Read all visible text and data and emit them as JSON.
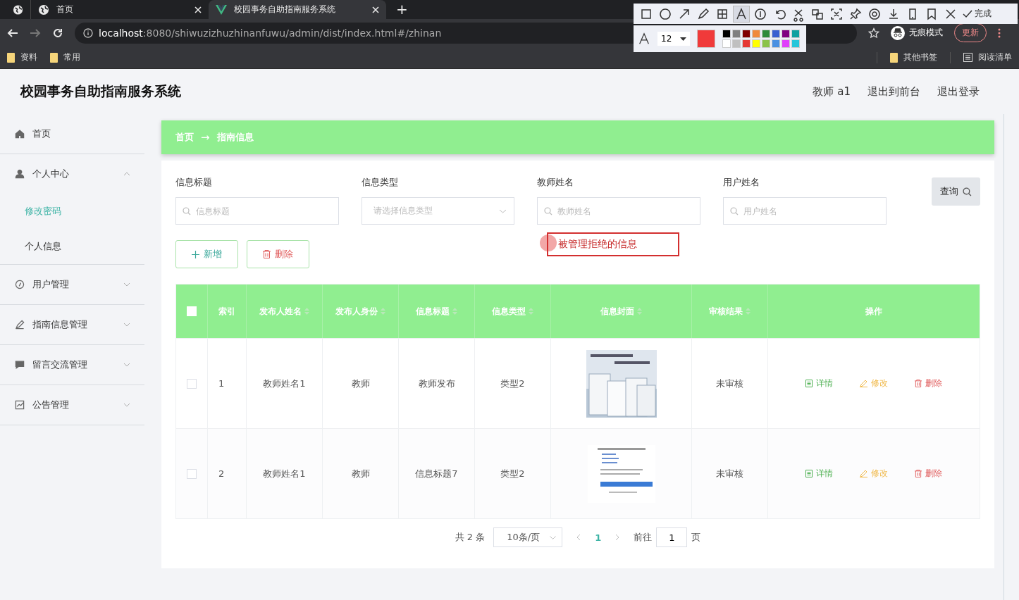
{
  "browser": {
    "tabs": [
      {
        "selected": false
      },
      {
        "title": "首页",
        "selected": false
      },
      {
        "title": "校园事务自助指南服务系统",
        "selected": true
      }
    ],
    "new_tab": "+",
    "url": {
      "host": "localhost",
      "rest": ":8080/shiwuzizhuzhinanfuwu/admin/dist/index.html#/zhinan"
    },
    "incognito": "无痕模式",
    "update": "更新",
    "bookmarks": [
      "资料",
      "常用"
    ],
    "right_bookmarks": [
      "其他书签",
      "阅读清单"
    ]
  },
  "annotation_toolbar": {
    "tools": [
      {
        "kind": "rect",
        "selected": false
      },
      {
        "kind": "circle",
        "selected": false
      },
      {
        "kind": "arrow",
        "selected": false
      },
      {
        "kind": "pencil",
        "selected": false
      },
      {
        "kind": "mosaic",
        "selected": false
      },
      {
        "kind": "text",
        "selected": true
      },
      {
        "kind": "number",
        "selected": false
      },
      {
        "kind": "undo",
        "selected": false
      },
      {
        "kind": "cut",
        "selected": false
      },
      {
        "kind": "translate",
        "selected": false
      },
      {
        "kind": "ocr",
        "selected": false
      },
      {
        "kind": "pin",
        "selected": false
      },
      {
        "kind": "record",
        "selected": false
      },
      {
        "kind": "download",
        "selected": false
      },
      {
        "kind": "phone",
        "selected": false
      },
      {
        "kind": "bookmark",
        "selected": false
      },
      {
        "kind": "close",
        "selected": false
      }
    ],
    "done": "完成",
    "font_size": "12",
    "palette": [
      {
        "color": "#000000"
      },
      {
        "color": "#808080"
      },
      {
        "color": "#800000"
      },
      {
        "color": "#f08a3c"
      },
      {
        "color": "#2e8b3a"
      },
      {
        "color": "#3a5fd0"
      },
      {
        "color": "#800080"
      },
      {
        "color": "#10a0a0"
      },
      {
        "color": "#ffffff"
      },
      {
        "color": "#c0c0c0"
      },
      {
        "color": "#e53935"
      },
      {
        "color": "#ffff00"
      },
      {
        "color": "#8bc34a"
      },
      {
        "color": "#4a90e2"
      },
      {
        "color": "#e040fb"
      },
      {
        "color": "#26c6da"
      }
    ]
  },
  "annotation": {
    "text": "被管理拒绝的信息"
  },
  "app": {
    "title": "校园事务自助指南服务系统",
    "user_links": [
      "教师 a1",
      "退出到前台",
      "退出登录"
    ],
    "sidebar": [
      {
        "label": "首页"
      },
      {
        "label": "个人中心",
        "expanded": true,
        "children": [
          {
            "label": "修改密码",
            "selected": true
          },
          {
            "label": "个人信息",
            "selected": false
          }
        ]
      },
      {
        "label": "用户管理",
        "expanded": false
      },
      {
        "label": "指南信息管理",
        "expanded": false
      },
      {
        "label": "留言交流管理",
        "expanded": false
      },
      {
        "label": "公告管理",
        "expanded": false
      }
    ],
    "breadcrumb": [
      "首页",
      "指南信息"
    ],
    "breadcrumb_separator": "→",
    "filters": [
      {
        "label": "信息标题",
        "placeholder": "信息标题",
        "kind": "input"
      },
      {
        "label": "信息类型",
        "placeholder": "请选择信息类型",
        "kind": "select"
      },
      {
        "label": "教师姓名",
        "placeholder": "教师姓名",
        "kind": "input"
      },
      {
        "label": "用户姓名",
        "placeholder": "用户姓名",
        "kind": "input"
      }
    ],
    "search_button": "查询",
    "actions": [
      {
        "label": "新增",
        "kind": "add"
      },
      {
        "label": "删除",
        "kind": "delete"
      }
    ],
    "table": {
      "all_checked": false,
      "columns": [
        {
          "label": "索引",
          "sortable": false
        },
        {
          "label": "发布人姓名",
          "sortable": true
        },
        {
          "label": "发布人身份",
          "sortable": true
        },
        {
          "label": "信息标题",
          "sortable": true
        },
        {
          "label": "信息类型",
          "sortable": true
        },
        {
          "label": "信息封面",
          "sortable": true
        },
        {
          "label": "审核结果",
          "sortable": true
        },
        {
          "label": "操作",
          "sortable": false
        }
      ],
      "rows": [
        {
          "checked": false,
          "cells": [
            "1",
            "教师姓名1",
            "教师",
            "教师发布",
            "类型2"
          ],
          "status": "未审核",
          "actions": [
            {
              "label": "详情",
              "kind": "detail"
            },
            {
              "label": "修改",
              "kind": "edit"
            },
            {
              "label": "删除",
              "kind": "delete"
            }
          ]
        },
        {
          "checked": false,
          "cells": [
            "2",
            "教师姓名1",
            "教师",
            "信息标题7",
            "类型2"
          ],
          "status": "未审核",
          "actions": [
            {
              "label": "详情",
              "kind": "detail"
            },
            {
              "label": "修改",
              "kind": "edit"
            },
            {
              "label": "删除",
              "kind": "delete"
            }
          ]
        }
      ]
    },
    "pagination": {
      "total": "共 2 条",
      "page_size": "10条/页",
      "pages": [
        {
          "label": "1",
          "selected": true
        }
      ],
      "goto": "前往",
      "goto_value": "1",
      "goto_suffix": "页"
    }
  }
}
